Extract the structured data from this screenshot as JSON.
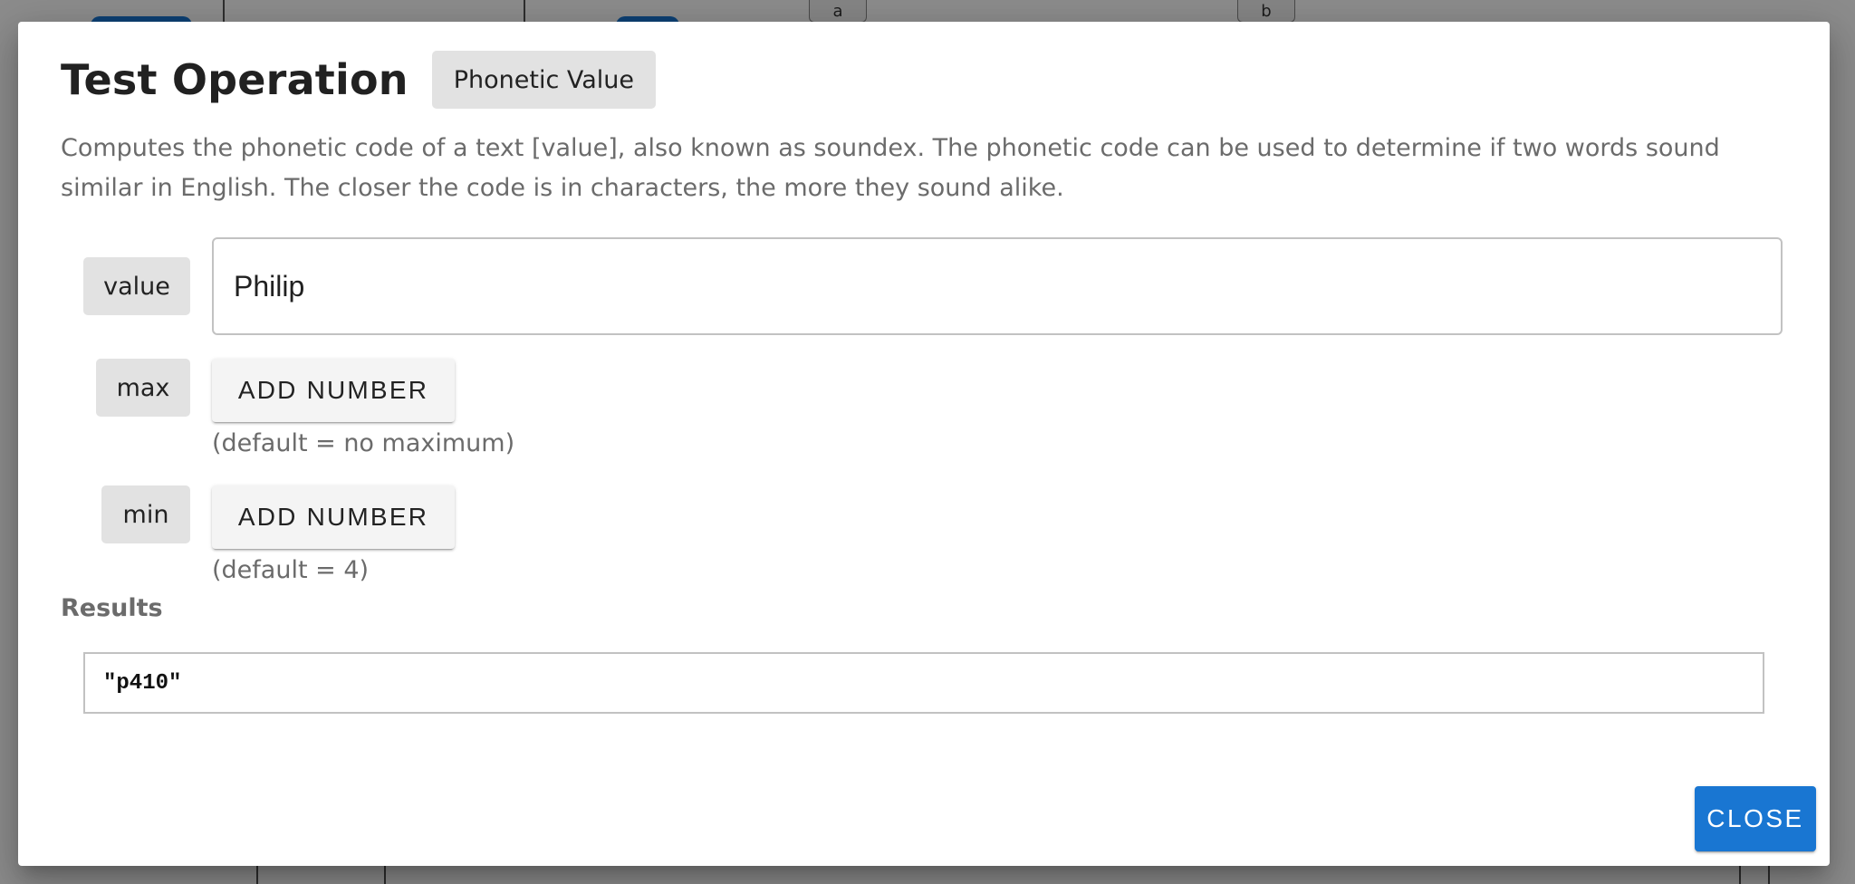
{
  "background": {
    "tab_a": "a",
    "tab_b": "b"
  },
  "dialog": {
    "title": "Test Operation",
    "operation_name": "Phonetic Value",
    "description": "Computes the phonetic code of a text [value], also known as soundex. The phonetic code can be used to determine if two words sound similar in English. The closer the code is in characters, the more they sound alike.",
    "params": {
      "value": {
        "label": "value",
        "input_value": "Philip"
      },
      "max": {
        "label": "max",
        "button_label": "ADD NUMBER",
        "hint": "(default = no maximum)"
      },
      "min": {
        "label": "min",
        "button_label": "ADD NUMBER",
        "hint": "(default = 4)"
      }
    },
    "results_label": "Results",
    "result_value": "\"p410\"",
    "close_label": "CLOSE"
  },
  "colors": {
    "primary": "#1976d2",
    "chip_bg": "#e2e2e2",
    "muted_text": "#6b6b6b"
  }
}
